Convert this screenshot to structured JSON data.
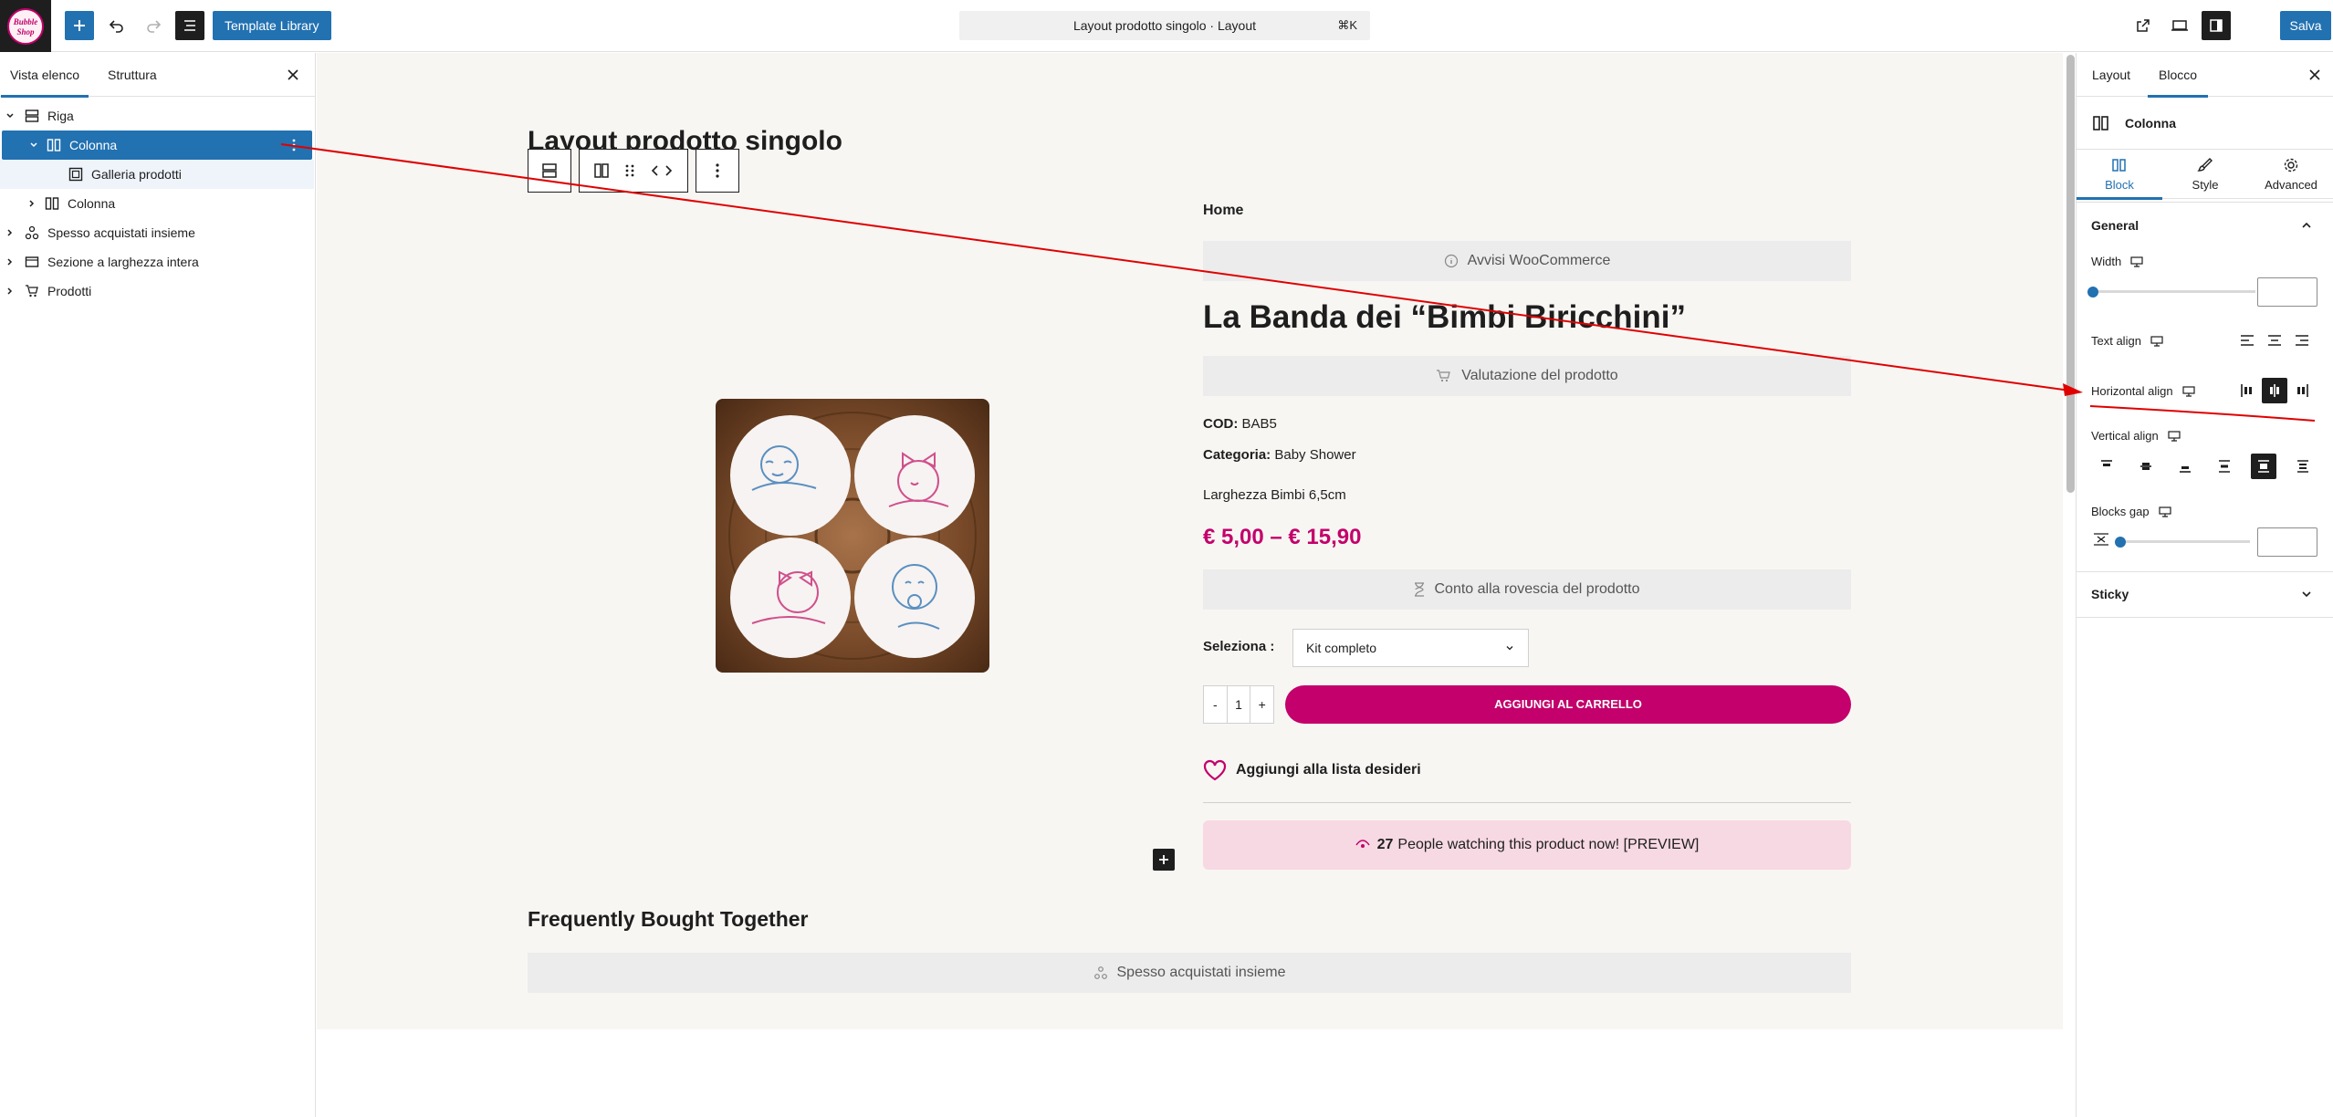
{
  "topbar": {
    "logo_text": "Bubble Shop",
    "template_library": "Template Library",
    "document_title": "Layout prodotto singolo · Layout",
    "shortcut": "⌘K",
    "save": "Salva"
  },
  "left_panel": {
    "tabs": [
      "Vista elenco",
      "Struttura"
    ],
    "tree": [
      {
        "label": "Riga"
      },
      {
        "label": "Colonna"
      },
      {
        "label": "Galleria prodotti"
      },
      {
        "label": "Colonna"
      },
      {
        "label": "Spesso acquistati insieme"
      },
      {
        "label": "Sezione a larghezza intera"
      },
      {
        "label": "Prodotti"
      }
    ]
  },
  "canvas": {
    "page_title": "Layout prodotto singolo",
    "breadcrumb": "Home",
    "notices_placeholder": "Avvisi WooCommerce",
    "product_title": "La Banda dei “Bimbi Biricchini”",
    "rating_placeholder": "Valutazione del prodotto",
    "sku_label": "COD:",
    "sku_value": "BAB5",
    "category_label": "Categoria:",
    "category_value": "Baby Shower",
    "short_description": "Larghezza Bimbi 6,5cm",
    "price": "€ 5,00 – € 15,90",
    "countdown_placeholder": "Conto alla rovescia del prodotto",
    "variation_label": "Seleziona :",
    "variation_value": "Kit completo",
    "qty_minus": "-",
    "qty_value": "1",
    "qty_plus": "+",
    "add_to_cart": "AGGIUNGI AL CARRELLO",
    "wishlist": "Aggiungi alla lista desideri",
    "watching_count": "27",
    "watching_text": "People watching this product now! [PREVIEW]",
    "fbt_title": "Frequently Bought Together",
    "fbt_placeholder": "Spesso acquistati insieme"
  },
  "right_panel": {
    "tabs": [
      "Layout",
      "Blocco"
    ],
    "block_name": "Colonna",
    "sub_tabs": [
      "Block",
      "Style",
      "Advanced"
    ],
    "general_title": "General",
    "width_label": "Width",
    "width_value": "",
    "text_align_label": "Text align",
    "horizontal_align_label": "Horizontal align",
    "horizontal_align_selected": "center",
    "vertical_align_label": "Vertical align",
    "vertical_align_selected": "stretch",
    "blocks_gap_label": "Blocks gap",
    "blocks_gap_value": "",
    "sticky_title": "Sticky"
  },
  "colors": {
    "accent": "#2271b1",
    "brand": "#c3006b",
    "annotation": "#e00000"
  }
}
